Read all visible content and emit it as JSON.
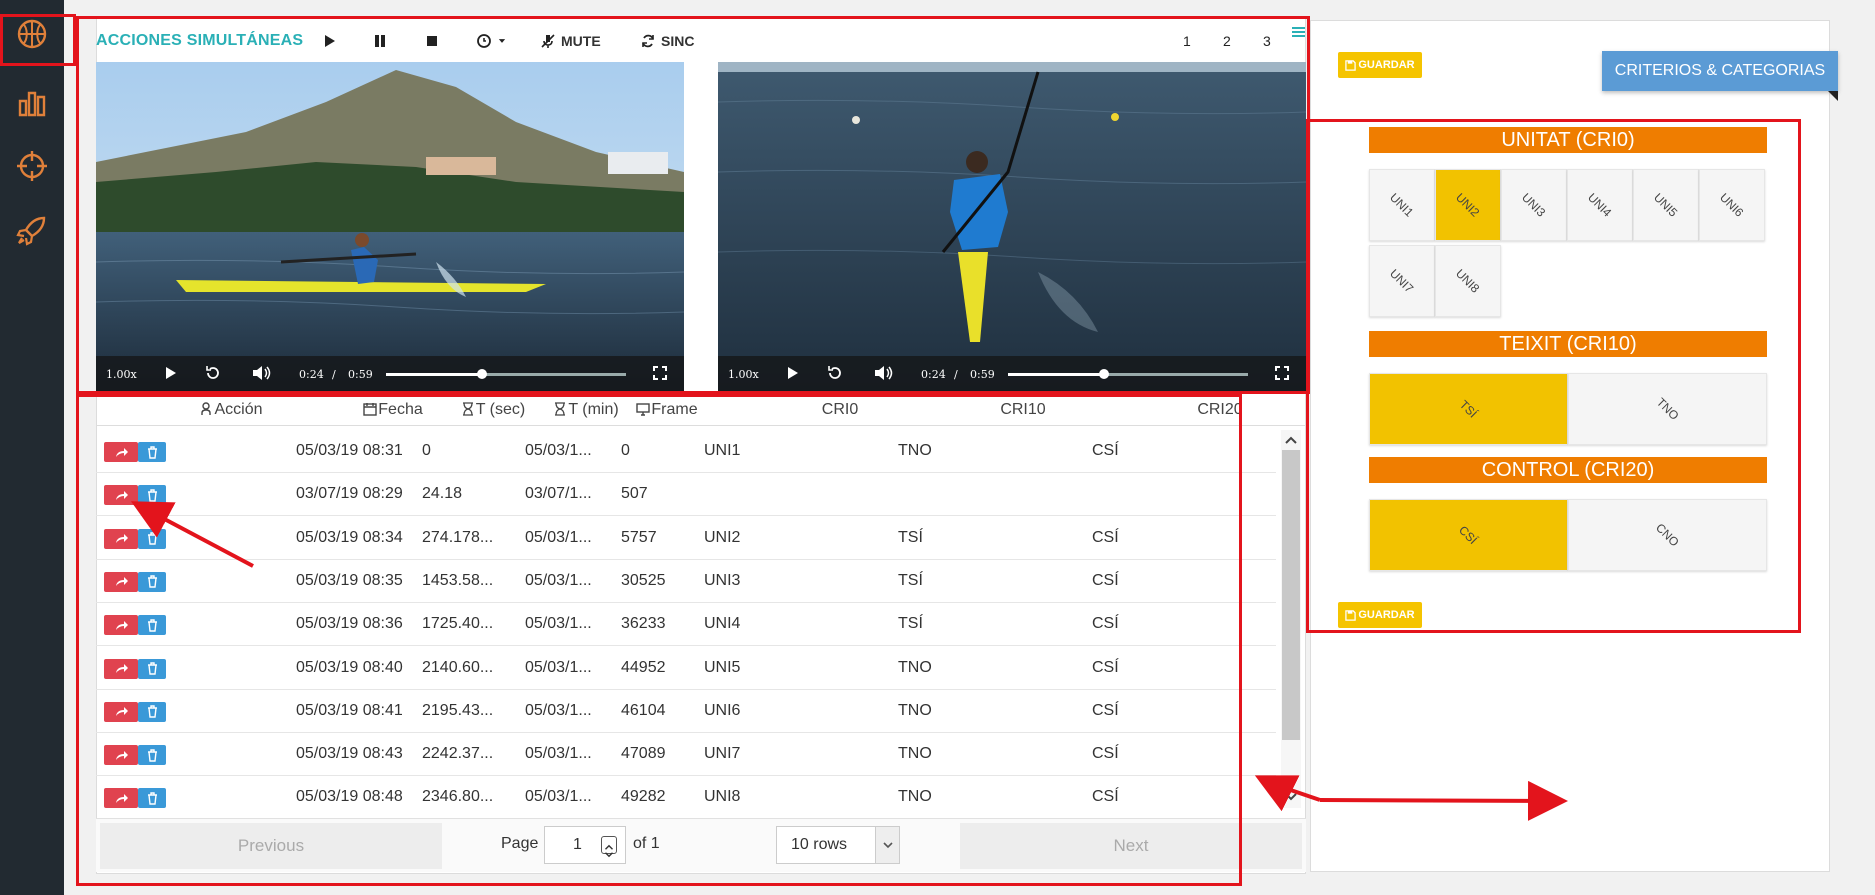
{
  "sidebar": {
    "items": [
      {
        "icon": "basketball-icon"
      },
      {
        "icon": "bar-chart-icon"
      },
      {
        "icon": "crosshair-icon"
      },
      {
        "icon": "rocket-icon"
      }
    ]
  },
  "toolbar": {
    "title": "ACCIONES SIMULTÁNEAS",
    "mute_label": "MUTE",
    "sinc_label": "SINC",
    "pages": [
      "1",
      "2",
      "3"
    ]
  },
  "videos": [
    {
      "speed": "1.00x",
      "time": "0:24",
      "sep": "/",
      "duration": "0:59",
      "progress": 0.4
    },
    {
      "speed": "1.00x",
      "time": "0:24",
      "sep": "/",
      "duration": "0:59",
      "progress": 0.4
    }
  ],
  "table": {
    "headers": [
      "Acción",
      "Fecha",
      "T (sec)",
      "T (min)",
      "Frame",
      "CRI0",
      "CRI10",
      "CRI20"
    ],
    "rows": [
      {
        "fecha": "05/03/19 08:31",
        "tsec": "0",
        "tmin": "05/03/1...",
        "frame": "0",
        "cri0": "UNI1",
        "cri10": "TNO",
        "cri20": "CSÍ"
      },
      {
        "fecha": "03/07/19 08:29",
        "tsec": "24.18",
        "tmin": "03/07/1...",
        "frame": "507",
        "cri0": "",
        "cri10": "",
        "cri20": ""
      },
      {
        "fecha": "05/03/19 08:34",
        "tsec": "274.178...",
        "tmin": "05/03/1...",
        "frame": "5757",
        "cri0": "UNI2",
        "cri10": "TSÍ",
        "cri20": "CSÍ"
      },
      {
        "fecha": "05/03/19 08:35",
        "tsec": "1453.58...",
        "tmin": "05/03/1...",
        "frame": "30525",
        "cri0": "UNI3",
        "cri10": "TSÍ",
        "cri20": "CSÍ"
      },
      {
        "fecha": "05/03/19 08:36",
        "tsec": "1725.40...",
        "tmin": "05/03/1...",
        "frame": "36233",
        "cri0": "UNI4",
        "cri10": "TSÍ",
        "cri20": "CSÍ"
      },
      {
        "fecha": "05/03/19 08:40",
        "tsec": "2140.60...",
        "tmin": "05/03/1...",
        "frame": "44952",
        "cri0": "UNI5",
        "cri10": "TNO",
        "cri20": "CSÍ"
      },
      {
        "fecha": "05/03/19 08:41",
        "tsec": "2195.43...",
        "tmin": "05/03/1...",
        "frame": "46104",
        "cri0": "UNI6",
        "cri10": "TNO",
        "cri20": "CSÍ"
      },
      {
        "fecha": "05/03/19 08:43",
        "tsec": "2242.37...",
        "tmin": "05/03/1...",
        "frame": "47089",
        "cri0": "UNI7",
        "cri10": "TNO",
        "cri20": "CSÍ"
      },
      {
        "fecha": "05/03/19 08:48",
        "tsec": "2346.80...",
        "tmin": "05/03/1...",
        "frame": "49282",
        "cri0": "UNI8",
        "cri10": "TNO",
        "cri20": "CSÍ"
      }
    ]
  },
  "pager": {
    "previous": "Previous",
    "page_label": "Page",
    "page_value": "1",
    "of_label": "of 1",
    "rows_value": "10 rows",
    "next": "Next"
  },
  "right": {
    "guardar": "GUARDAR",
    "criteria_button": "CRITERIOS & CATEGORIAS",
    "categories": [
      {
        "title": "UNITAT (CRI0)",
        "options": [
          "UNI1",
          "UNI2",
          "UNI3",
          "UNI4",
          "UNI5",
          "UNI6",
          "UNI7",
          "UNI8"
        ],
        "selected": "UNI2"
      },
      {
        "title": "TEIXIT (CRI10)",
        "options": [
          "TSÍ",
          "TNO"
        ],
        "selected": "TSÍ"
      },
      {
        "title": "CONTROL (CRI20)",
        "options": [
          "CSÍ",
          "CNO"
        ],
        "selected": "CSÍ"
      }
    ]
  },
  "colors": {
    "accent_teal": "#2ab0b6",
    "category_orange": "#ef7d00",
    "selected_yellow": "#f2c200",
    "go_red": "#e0434f",
    "delete_blue": "#3a99d8",
    "annotation_red": "#e3141c"
  }
}
